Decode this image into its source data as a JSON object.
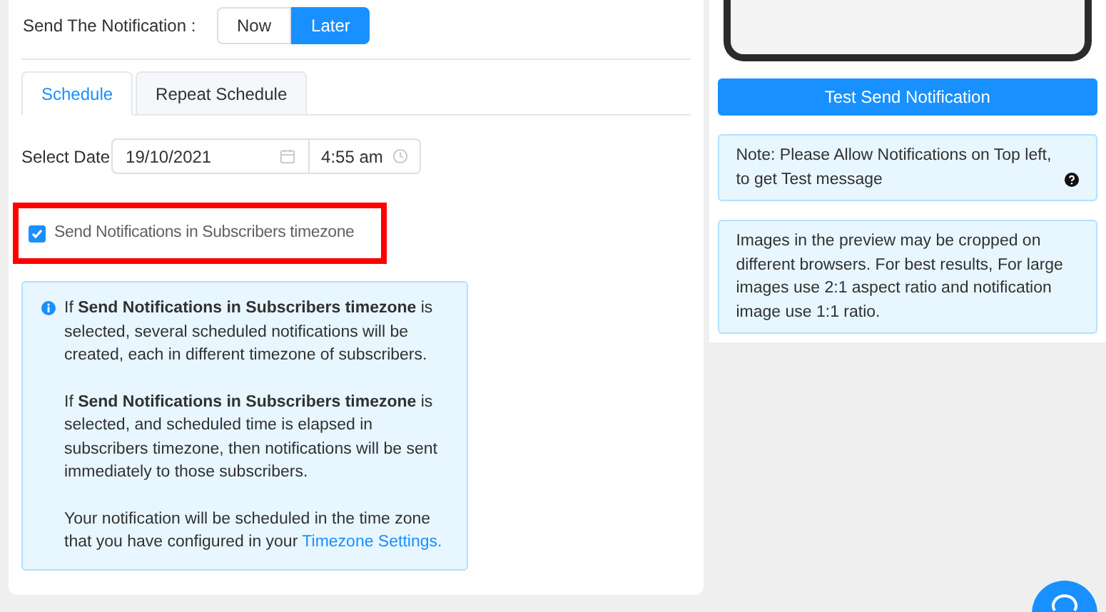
{
  "send_mode": {
    "label": "Send The Notification :",
    "options": [
      {
        "label": "Now",
        "selected": false
      },
      {
        "label": "Later",
        "selected": true
      }
    ]
  },
  "tabs": [
    {
      "label": "Schedule",
      "selected": true
    },
    {
      "label": "Repeat Schedule",
      "selected": false
    }
  ],
  "date": {
    "label": "Select Date",
    "date_value": "19/10/2021",
    "time_value": "4:55 am"
  },
  "timezone_option": {
    "label": "Send Notifications in Subscribers timezone",
    "checked": true,
    "highlighted": true
  },
  "info": {
    "paragraphs": [
      "If **Send Notifications in Subscribers timezone** is selected, several scheduled notifications will be created, each in different timezone of subscribers.",
      "If **Send Notifications in Subscribers timezone** is selected, and scheduled time is elapsed in subscribers timezone, then notifications will be sent immediately to those subscribers."
    ],
    "last_paragraph": "Your notification will be scheduled in the time zone that you have configured in your",
    "link": "Timezone Settings."
  },
  "test_button": "Test Send Notification",
  "notes": [
    "Note: Please Allow Notifications on Top left, to get Test message",
    "Images in the preview may be cropped on different browsers. For best results, For large images use 2:1 aspect ratio and notification image use 1:1 ratio."
  ]
}
